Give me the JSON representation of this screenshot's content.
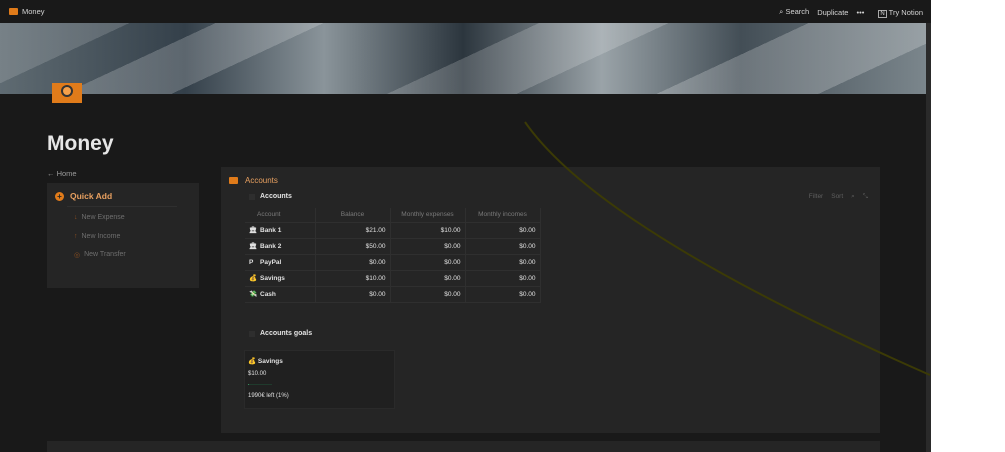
{
  "topbar": {
    "title": "Money",
    "search": "Search",
    "duplicate": "Duplicate",
    "more": "•••",
    "try": "Try Notion"
  },
  "page": {
    "title": "Money",
    "back": "← Home"
  },
  "quick_add": {
    "title": "Quick Add",
    "items": [
      {
        "label": "New Expense",
        "icon": "arrow-down"
      },
      {
        "label": "New Income",
        "icon": "arrow-up"
      },
      {
        "label": "New Transfer",
        "icon": "transfer"
      }
    ]
  },
  "accounts": {
    "title": "Accounts",
    "view": "Accounts",
    "filter": "Filter",
    "sort": "Sort",
    "columns": [
      "Account",
      "Balance",
      "Monthly expenses",
      "Monthly incomes"
    ],
    "rows": [
      {
        "icon": "🏛",
        "name": "Bank 1",
        "balance": "$21.00",
        "exp": "$10.00",
        "inc": "$0.00"
      },
      {
        "icon": "🏛",
        "name": "Bank 2",
        "balance": "$50.00",
        "exp": "$0.00",
        "inc": "$0.00"
      },
      {
        "icon": "P",
        "name": "PayPal",
        "balance": "$0.00",
        "exp": "$0.00",
        "inc": "$0.00"
      },
      {
        "icon": "💰",
        "name": "Savings",
        "balance": "$10.00",
        "exp": "$0.00",
        "inc": "$0.00"
      },
      {
        "icon": "💸",
        "name": "Cash",
        "balance": "$0.00",
        "exp": "$0.00",
        "inc": "$0.00"
      }
    ],
    "goals": {
      "title": "Accounts goals",
      "card": {
        "icon": "💰",
        "name": "Savings",
        "value": "$10.00",
        "progress": 0.01,
        "left": "1990€ left (1%)"
      }
    }
  },
  "colors": {
    "accent": "#e07b1a",
    "bg": "#191919",
    "panel": "#252525"
  }
}
